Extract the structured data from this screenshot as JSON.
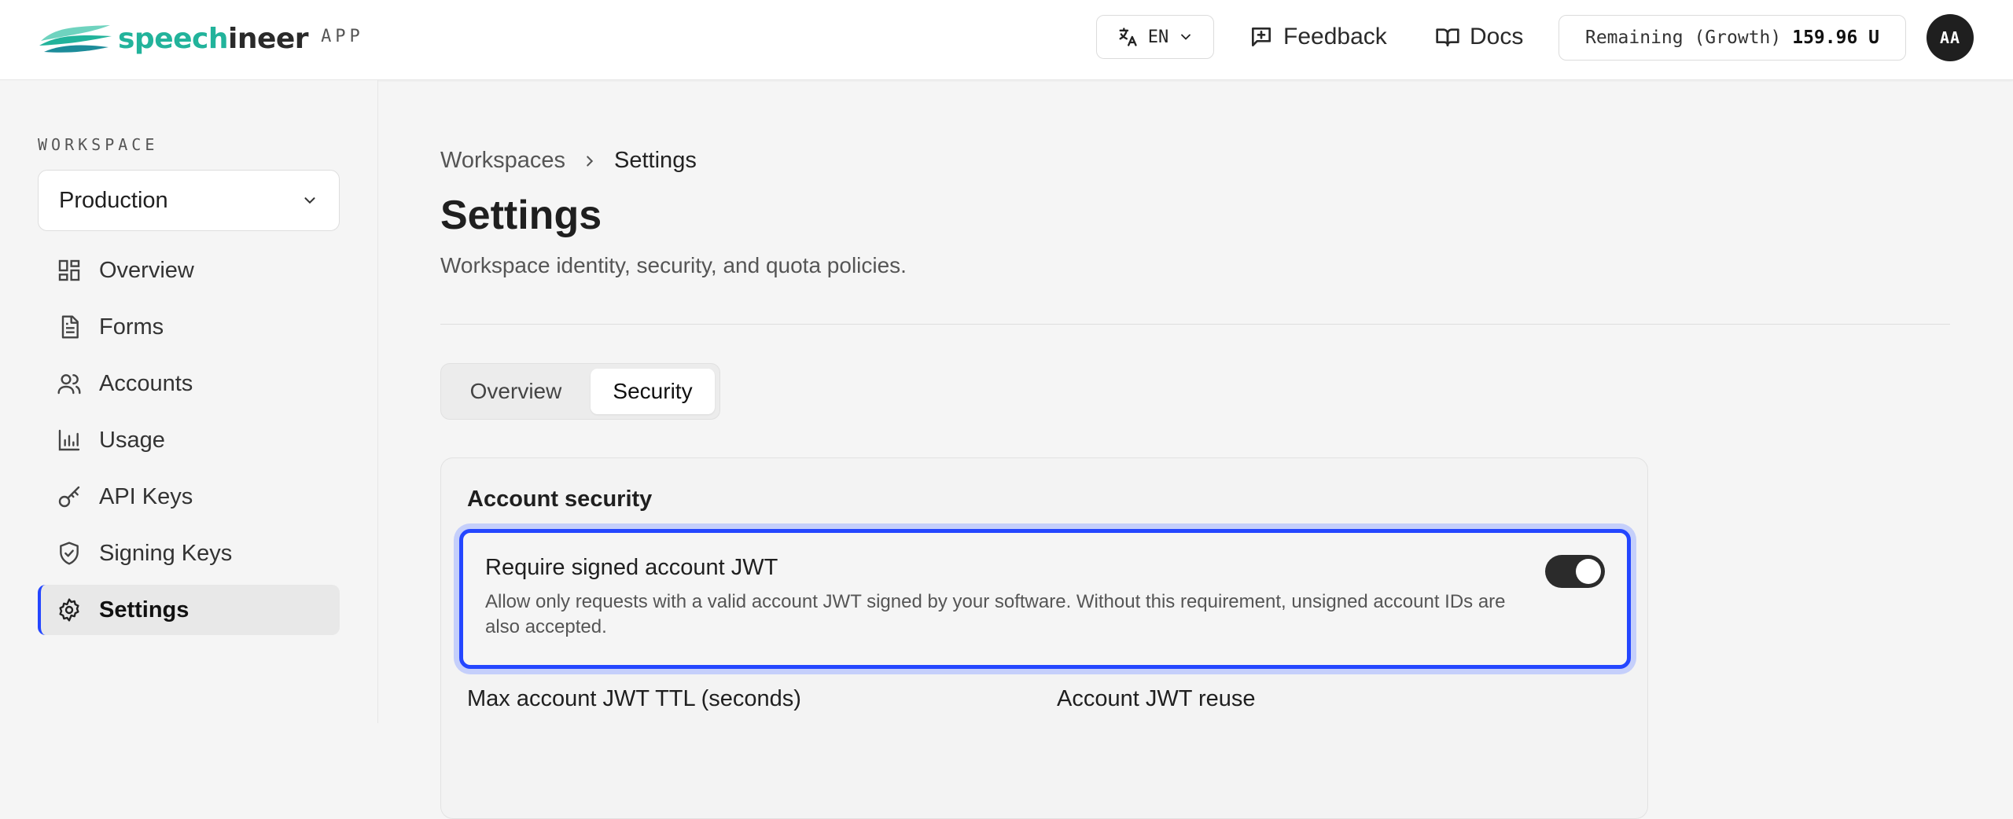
{
  "header": {
    "brand_part1": "speech",
    "brand_part2": "ineer",
    "brand_suffix": "APP",
    "language": "EN",
    "feedback_label": "Feedback",
    "docs_label": "Docs",
    "remaining_label": "Remaining (Growth)",
    "remaining_value": "159.96 U",
    "avatar_initials": "AA"
  },
  "sidebar": {
    "workspace_label": "WORKSPACE",
    "workspace_selected": "Production",
    "items": [
      {
        "label": "Overview",
        "icon": "dashboard-icon"
      },
      {
        "label": "Forms",
        "icon": "document-icon"
      },
      {
        "label": "Accounts",
        "icon": "users-icon"
      },
      {
        "label": "Usage",
        "icon": "bar-chart-icon"
      },
      {
        "label": "API Keys",
        "icon": "key-icon"
      },
      {
        "label": "Signing Keys",
        "icon": "shield-check-icon"
      },
      {
        "label": "Settings",
        "icon": "gear-icon",
        "active": true
      }
    ]
  },
  "main": {
    "breadcrumb": {
      "parent": "Workspaces",
      "current": "Settings"
    },
    "title": "Settings",
    "subtitle": "Workspace identity, security, and quota policies.",
    "tabs": [
      {
        "label": "Overview"
      },
      {
        "label": "Security",
        "active": true
      }
    ],
    "card": {
      "title": "Account security",
      "setting": {
        "title": "Require signed account JWT",
        "description": "Allow only requests with a valid account JWT signed by your software. Without this requirement, unsigned account IDs are also accepted.",
        "enabled": true
      },
      "fields": [
        {
          "label": "Max account JWT TTL (seconds)"
        },
        {
          "label": "Account JWT reuse"
        }
      ]
    }
  },
  "colors": {
    "accent": "#2446ff",
    "brand_green": "#22b39b"
  }
}
